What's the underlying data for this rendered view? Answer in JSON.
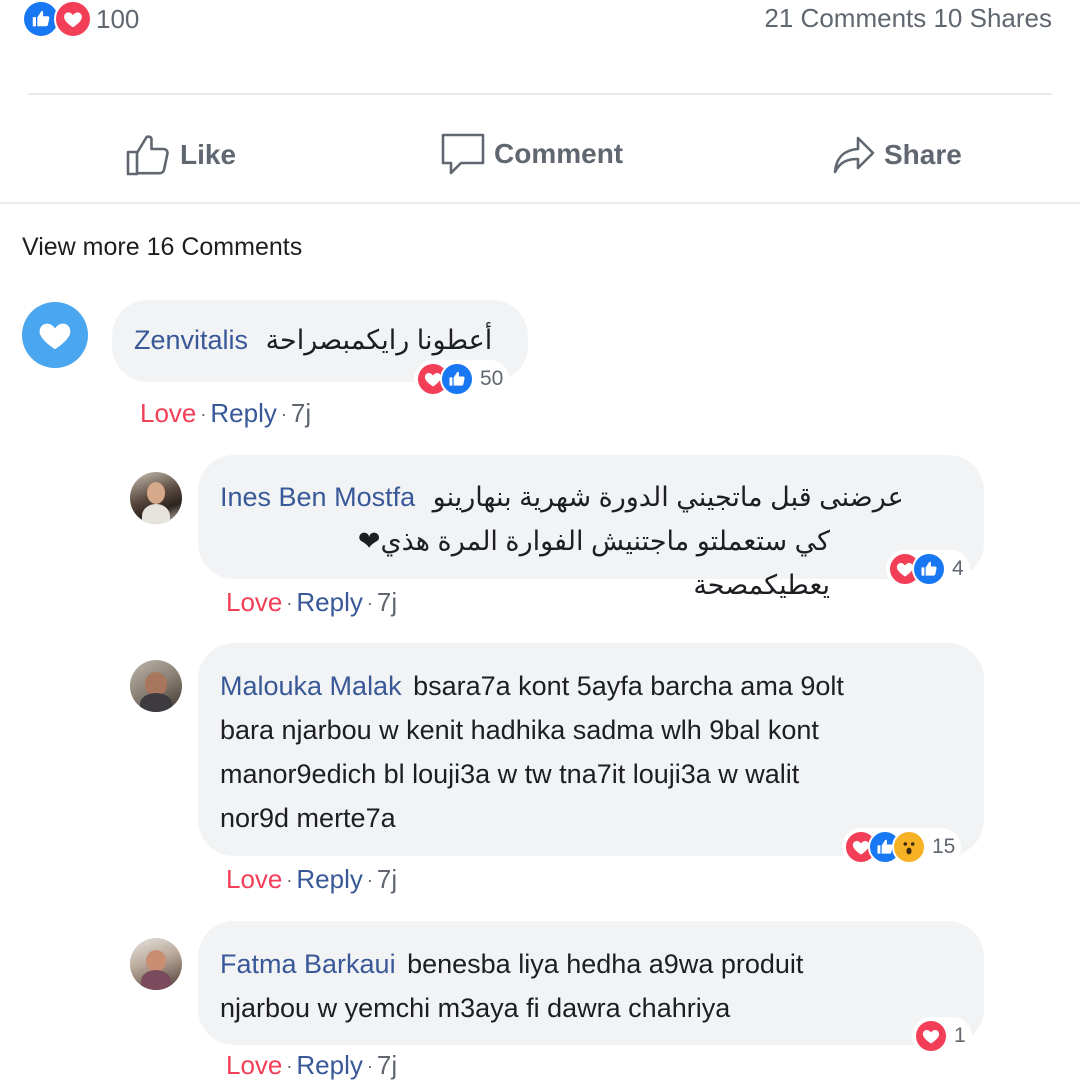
{
  "post": {
    "reaction_count": "100",
    "stats": "21 Comments 10 Shares",
    "actions": {
      "like": "Like",
      "comment": "Comment",
      "share": "Share"
    },
    "view_more": "View more 16 Comments"
  },
  "colors": {
    "like": "#1877f2",
    "love": "#f33e58",
    "name": "#385898",
    "muted": "#606770",
    "bubble": "#f2f3f5"
  },
  "comments": [
    {
      "author": "Zenvitalis",
      "text": "أعطونا رايكمبصراحة",
      "reaction_icons": [
        "love-icon",
        "like-icon"
      ],
      "reaction_count": "50",
      "love_label": "Love",
      "reply_label": "Reply",
      "dot": "·",
      "time": "7j"
    },
    {
      "author": "Ines Ben Mostfa",
      "text_line1": "عرضنى قبل ماتجيني الدورة شهرية بنهارينو",
      "text_line2": "كي ستعملتو ماجتنيش الفوارة المرة هذي❤  يعطيكمصحة",
      "reaction_icons": [
        "love-icon",
        "like-icon"
      ],
      "reaction_count": "4",
      "love_label": "Love",
      "reply_label": "Reply",
      "dot": "·",
      "time": "7j"
    },
    {
      "author": "Malouka Malak",
      "text_line1": "bsara7a kont 5ayfa barcha ama 9olt",
      "text_line2": "bara njarbou w kenit hadhika sadma wlh 9bal kont",
      "text_line3": "manor9edich bl louji3a w tw tna7it louji3a w walit",
      "text_line4": "nor9d merte7a",
      "reaction_icons": [
        "love-icon",
        "like-icon",
        "wow-icon"
      ],
      "reaction_count": "15",
      "love_label": "Love",
      "reply_label": "Reply",
      "dot": "·",
      "time": "7j"
    },
    {
      "author": "Fatma Barkaui",
      "text_line1": "benesba liya hedha a9wa produit",
      "text_line2": "njarbou w yemchi m3aya fi dawra chahriya",
      "reaction_icons": [
        "love-icon"
      ],
      "reaction_count": "1",
      "love_label": "Love",
      "reply_label": "Reply",
      "dot": "·",
      "time": "7j"
    }
  ]
}
